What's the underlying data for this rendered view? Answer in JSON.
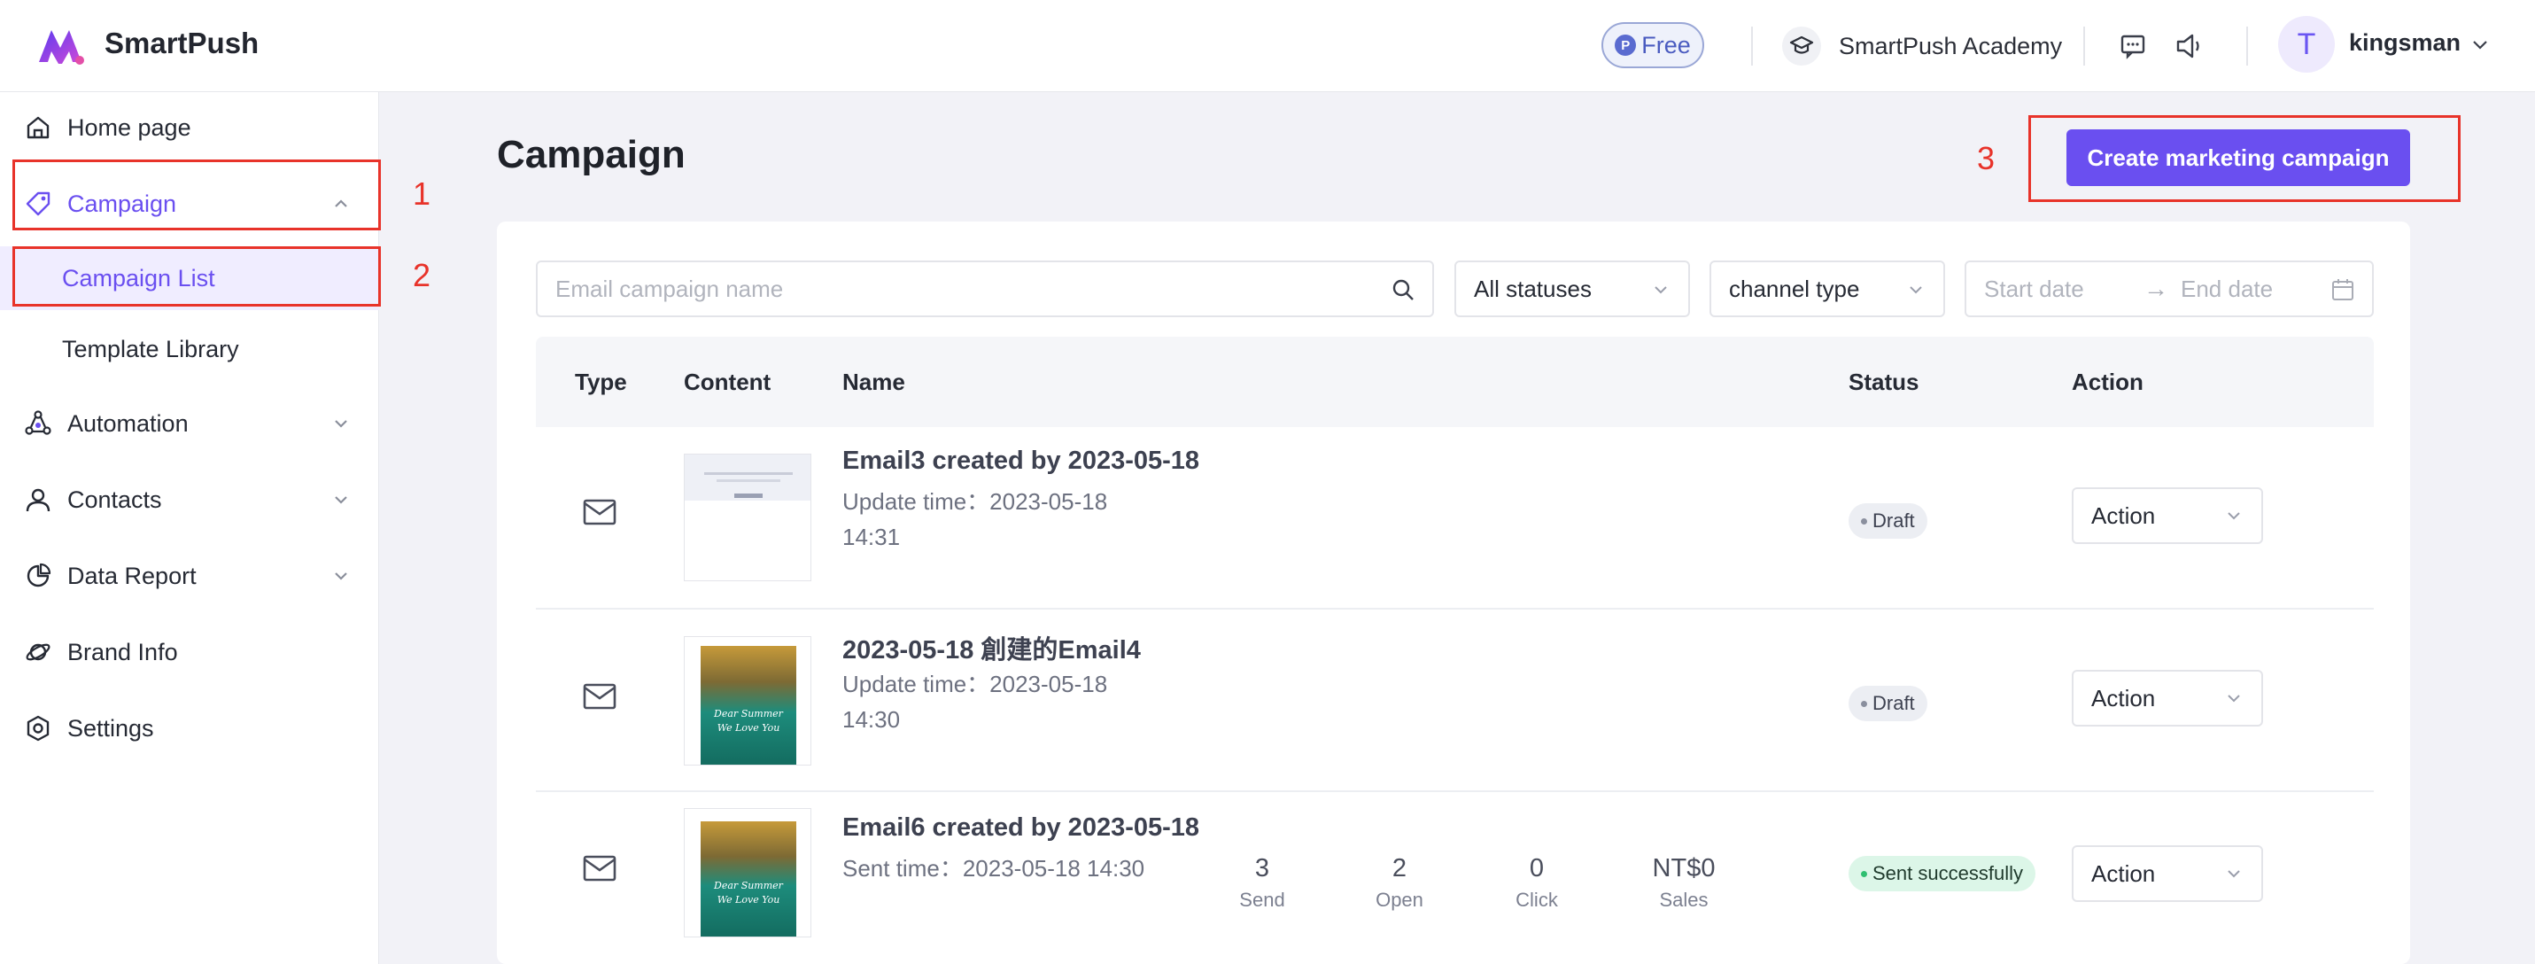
{
  "header": {
    "brand": "SmartPush",
    "plan_badge": "Free",
    "academy_label": "SmartPush Academy",
    "avatar_initial": "T",
    "username": "kingsman"
  },
  "sidebar": {
    "items": [
      {
        "label": "Home page",
        "icon": "home-icon"
      },
      {
        "label": "Campaign",
        "icon": "tag-icon",
        "expanded": true
      },
      {
        "label": "Automation",
        "icon": "automation-icon"
      },
      {
        "label": "Contacts",
        "icon": "person-icon"
      },
      {
        "label": "Data Report",
        "icon": "pie-chart-icon"
      },
      {
        "label": "Brand Info",
        "icon": "planet-icon"
      },
      {
        "label": "Settings",
        "icon": "gear-icon"
      }
    ],
    "campaign_sub": [
      {
        "label": "Campaign List",
        "selected": true
      },
      {
        "label": "Template Library"
      }
    ]
  },
  "annotations": [
    "1",
    "2",
    "3"
  ],
  "main": {
    "title": "Campaign",
    "create_button": "Create marketing campaign"
  },
  "filters": {
    "search_placeholder": "Email campaign name",
    "status_select": "All statuses",
    "channel_select": "channel type",
    "start_placeholder": "Start date",
    "end_placeholder": "End date"
  },
  "table": {
    "columns": [
      "Type",
      "Content",
      "Name",
      "Status",
      "Action"
    ],
    "rows": [
      {
        "type_icon": "mail-icon",
        "name": "Email3 created by 2023-05-18",
        "time_line1": "Update time：2023-05-18",
        "time_line2": "14:31",
        "status": "Draft",
        "action": "Action"
      },
      {
        "type_icon": "mail-icon",
        "name": "2023-05-18 創建的Email4",
        "time_line1": "Update time：2023-05-18",
        "time_line2": "14:30",
        "thumb_text": [
          "Dear Summer",
          "We Love You"
        ],
        "status": "Draft",
        "action": "Action"
      },
      {
        "type_icon": "mail-icon",
        "name": "Email6 created by 2023-05-18",
        "time_line1": "Sent time：2023-05-18 14:30",
        "thumb_text": [
          "Dear Summer",
          "We Love You"
        ],
        "metrics": [
          {
            "value": "3",
            "label": "Send"
          },
          {
            "value": "2",
            "label": "Open"
          },
          {
            "value": "0",
            "label": "Click"
          },
          {
            "value": "NT$0",
            "label": "Sales"
          }
        ],
        "status": "Sent successfully",
        "action": "Action"
      }
    ]
  },
  "colors": {
    "accent": "#6a4ff0",
    "annotation_red": "#e8332a",
    "sent_bg": "#dcf6e8",
    "draft_bg": "#eceef3"
  }
}
